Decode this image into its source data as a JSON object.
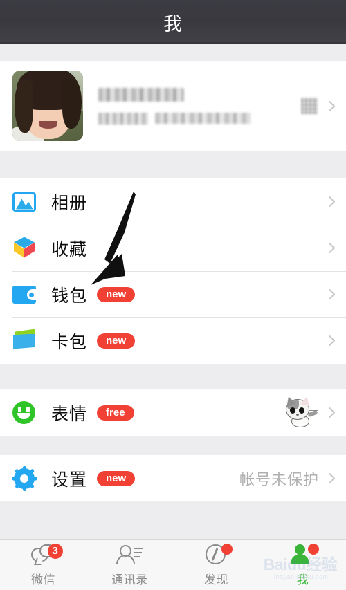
{
  "header": {
    "title": "我"
  },
  "profile": {
    "name_redacted": true,
    "name": "",
    "id_label_redacted": true,
    "id_label": "微信号:",
    "id_value": "",
    "qr_icon": "qr-code-icon",
    "chevron": "chevron-right-icon"
  },
  "menu_groups": [
    {
      "items": [
        {
          "label": "相册",
          "icon": "photo-album-icon",
          "badge": "",
          "note": "",
          "thumb": ""
        },
        {
          "label": "收藏",
          "icon": "favorites-cube-icon",
          "badge": "",
          "note": "",
          "thumb": ""
        },
        {
          "label": "钱包",
          "icon": "wallet-icon",
          "badge": "new",
          "note": "",
          "thumb": ""
        },
        {
          "label": "卡包",
          "icon": "card-holder-icon",
          "badge": "new",
          "note": "",
          "thumb": ""
        }
      ]
    },
    {
      "items": [
        {
          "label": "表情",
          "icon": "smiley-face-icon",
          "badge": "free",
          "note": "",
          "thumb": "cat-sticker-thumbnail"
        }
      ]
    },
    {
      "items": [
        {
          "label": "设置",
          "icon": "gear-icon",
          "badge": "new",
          "note": "帐号未保护",
          "thumb": ""
        }
      ]
    }
  ],
  "tabbar": {
    "tabs": [
      {
        "label": "微信",
        "icon": "chat-bubbles-icon",
        "badge": "3",
        "badge_type": "count",
        "active": false
      },
      {
        "label": "通讯录",
        "icon": "contacts-person-icon",
        "badge": "",
        "badge_type": "none",
        "active": false
      },
      {
        "label": "发现",
        "icon": "compass-icon",
        "badge": "",
        "badge_type": "dot",
        "active": false
      },
      {
        "label": "我",
        "icon": "profile-person-icon",
        "badge": "",
        "badge_type": "dot",
        "active": true
      }
    ]
  },
  "annotation": {
    "arrow": "black-arrow-pointing-to-wallet-row"
  },
  "watermark": {
    "line1": "Baidu经验",
    "line2": "jingyan.baidu.com"
  },
  "colors": {
    "header_bg": "#39393f",
    "page_bg": "#ededf0",
    "card_bg": "#ffffff",
    "badge_red": "#f04134",
    "accent_blue": "#23a7f0",
    "accent_green": "#2fc428",
    "tab_active": "#3ab53a",
    "note_gray": "#b0b0b0"
  }
}
